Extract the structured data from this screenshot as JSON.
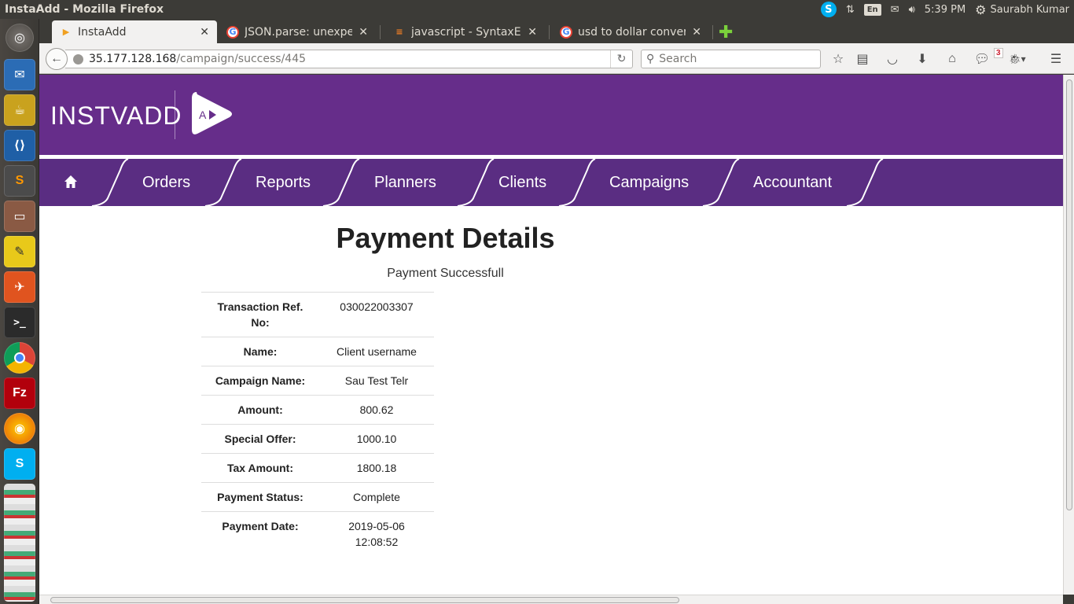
{
  "os": {
    "window_title": "InstaAdd - Mozilla Firefox",
    "keyboard_layout": "En",
    "clock": "5:39 PM",
    "user": "Saurabh Kumar",
    "user_menu_icon": "gear-icon"
  },
  "browser": {
    "tabs": [
      {
        "label": "InstaAdd",
        "favicon": "instaadd-icon",
        "active": true
      },
      {
        "label": "JSON.parse: unexpe…",
        "favicon": "google-icon",
        "active": false
      },
      {
        "label": "javascript - SyntaxEr…",
        "favicon": "stackoverflow-icon",
        "active": false
      },
      {
        "label": "usd to dollar conver…",
        "favicon": "google-icon",
        "active": false
      }
    ],
    "url_host": "35.177.128.168",
    "url_path": "/campaign/success/445",
    "search_placeholder": "Search",
    "notification_count": "3"
  },
  "site": {
    "logo_text": "INSTVADD",
    "logo_mark_text": "A",
    "nav": [
      {
        "label": "Orders"
      },
      {
        "label": "Reports"
      },
      {
        "label": "Planners"
      },
      {
        "label": "Clients"
      },
      {
        "label": "Campaigns"
      },
      {
        "label": "Accountant"
      }
    ],
    "colors": {
      "header": "#662d8a",
      "nav": "#5a2d82"
    }
  },
  "payment": {
    "title": "Payment Details",
    "status_message": "Payment Successfull",
    "rows": [
      {
        "label": "Transaction Ref. No:",
        "value": "030022003307"
      },
      {
        "label": "Name:",
        "value": "Client username"
      },
      {
        "label": "Campaign Name:",
        "value": "Sau Test Telr"
      },
      {
        "label": "Amount:",
        "value": "800.62"
      },
      {
        "label": "Special Offer:",
        "value": "1000.10"
      },
      {
        "label": "Tax Amount:",
        "value": "1800.18"
      },
      {
        "label": "Payment Status:",
        "value": "Complete"
      },
      {
        "label": "Payment Date:",
        "value": "2019-05-06 12:08:52"
      }
    ]
  }
}
